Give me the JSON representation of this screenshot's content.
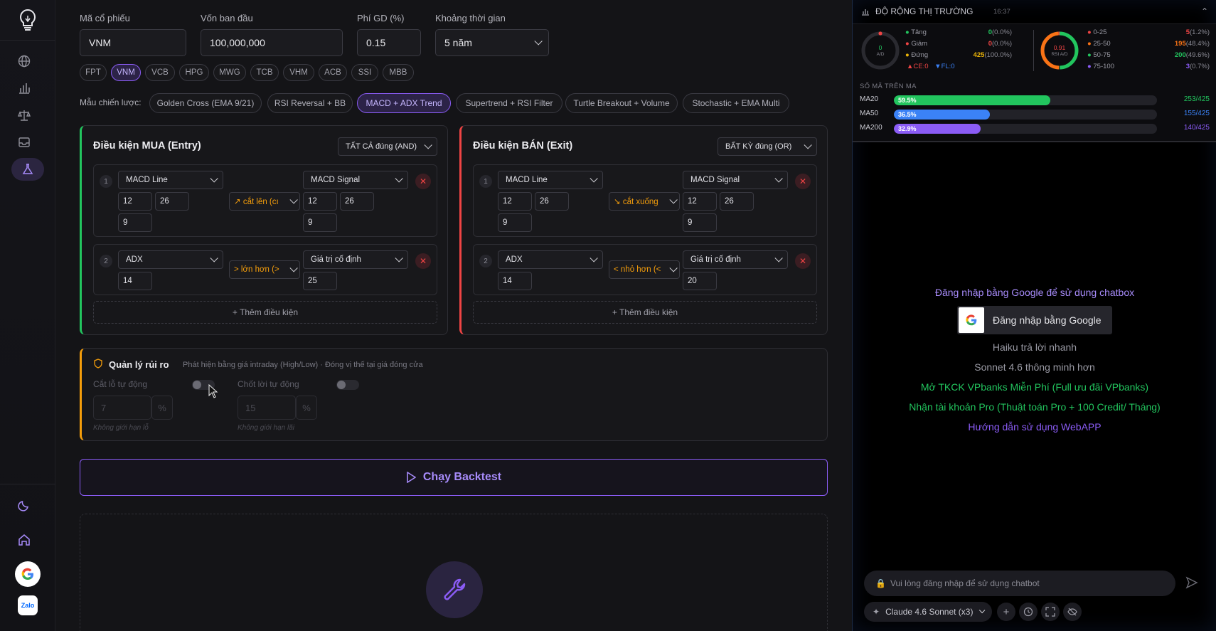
{
  "sidebar": {
    "items": [
      {
        "name": "globe-icon"
      },
      {
        "name": "bar-chart-icon"
      },
      {
        "name": "scale-icon"
      },
      {
        "name": "inbox-icon"
      },
      {
        "name": "flask-icon",
        "active": true
      }
    ],
    "bottom": [
      {
        "name": "moon-icon"
      },
      {
        "name": "home-icon"
      },
      {
        "name": "google-icon"
      },
      {
        "name": "zalo-icon",
        "label": "Zalo"
      }
    ]
  },
  "form": {
    "symbol_label": "Mã cổ phiếu",
    "symbol_value": "VNM",
    "capital_label": "Vốn ban đầu",
    "capital_value": "100,000,000",
    "fee_label": "Phí GD (%)",
    "fee_value": "0.15",
    "period_label": "Khoảng thời gian",
    "period_value": "5 năm"
  },
  "tickers": [
    "FPT",
    "VNM",
    "VCB",
    "HPG",
    "MWG",
    "TCB",
    "VHM",
    "ACB",
    "SSI",
    "MBB"
  ],
  "active_ticker": "VNM",
  "templates": {
    "label": "Mẫu chiến lược:",
    "items": [
      "Golden Cross (EMA 9/21)",
      "RSI Reversal + BB",
      "MACD + ADX Trend",
      "Supertrend + RSI Filter",
      "Turtle Breakout + Volume",
      "Stochastic + EMA Multi"
    ],
    "active": "MACD + ADX Trend"
  },
  "buy": {
    "title": "Điều kiện MUA (Entry)",
    "mode": "TẤT CẢ đúng (AND)",
    "conditions": [
      {
        "num": "1",
        "left": "MACD Line",
        "left_params": [
          "12",
          "26",
          "9"
        ],
        "op": "↗ cắt lên (cı",
        "right": "MACD Signal",
        "right_params": [
          "12",
          "26",
          "9"
        ]
      },
      {
        "num": "2",
        "left": "ADX",
        "left_params": [
          "14"
        ],
        "op": "> lớn hơn (>",
        "right": "Giá trị cố định",
        "right_params": [
          "25"
        ]
      }
    ],
    "add_label": "+ Thêm điều kiện"
  },
  "sell": {
    "title": "Điều kiện BÁN (Exit)",
    "mode": "BẤT KỲ đúng (OR)",
    "conditions": [
      {
        "num": "1",
        "left": "MACD Line",
        "left_params": [
          "12",
          "26",
          "9"
        ],
        "op": "↘ cắt xuống",
        "right": "MACD Signal",
        "right_params": [
          "12",
          "26",
          "9"
        ]
      },
      {
        "num": "2",
        "left": "ADX",
        "left_params": [
          "14"
        ],
        "op": "< nhỏ hơn (<",
        "right": "Giá trị cố định",
        "right_params": [
          "20"
        ]
      }
    ],
    "add_label": "+ Thêm điều kiện"
  },
  "risk": {
    "title": "Quản lý rủi ro",
    "subtitle": "Phát hiện bằng giá intraday (High/Low) · Đóng vị thế tại giá đóng cửa",
    "stop_loss_label": "Cắt lỗ tự động",
    "stop_loss_value": "7",
    "stop_loss_unit": "%",
    "stop_loss_hint": "Không giới hạn lỗ",
    "take_profit_label": "Chốt lời tự động",
    "take_profit_value": "15",
    "take_profit_unit": "%",
    "take_profit_hint": "Không giới hạn lãi"
  },
  "run_label": "Chạy Backtest",
  "market": {
    "title": "ĐỘ RỘNG THỊ TRƯỜNG",
    "time": "16:37",
    "ad_center": "0",
    "ad_sub": "A/D",
    "breadth": [
      {
        "label": "Tăng",
        "color": "#22c55e",
        "value": "0",
        "pct": "(0.0%)"
      },
      {
        "label": "Giảm",
        "color": "#ef4444",
        "value": "0",
        "pct": "(0.0%)"
      },
      {
        "label": "Đứng",
        "color": "#eab308",
        "value": "425",
        "pct": "(100.0%)"
      }
    ],
    "ce": "▲CE:0",
    "fl": "▼FL:0",
    "rsi_center": "0.91",
    "rsi_sub": "RSI A/D",
    "rsi": [
      {
        "label": "0-25",
        "color": "#ef4444",
        "value": "5",
        "pct": "(1.2%)"
      },
      {
        "label": "25-50",
        "color": "#f97316",
        "value": "195",
        "pct": "(48.4%)"
      },
      {
        "label": "50-75",
        "color": "#22c55e",
        "value": "200",
        "pct": "(49.6%)"
      },
      {
        "label": "75-100",
        "color": "#8b5cf6",
        "value": "3",
        "pct": "(0.7%)"
      }
    ],
    "ma_title": "SỐ MÃ TRÊN MA",
    "ma": [
      {
        "label": "MA20",
        "pct_label": "59.5%",
        "fraction": 0.595,
        "count": "253/425",
        "color": "#22c55e"
      },
      {
        "label": "MA50",
        "pct_label": "36.5%",
        "fraction": 0.365,
        "count": "155/425",
        "color": "#3b82f6"
      },
      {
        "label": "MA200",
        "pct_label": "32.9%",
        "fraction": 0.329,
        "count": "140/425",
        "color": "#8b5cf6"
      }
    ]
  },
  "chat": {
    "login_prompt": "Đăng nhập bằng Google để sử dụng chatbox",
    "login_button": "Đăng nhập bằng Google",
    "line1": "Haiku trả lời nhanh",
    "line2": "Sonnet 4.6 thông minh hơn",
    "link1": "Mở TKCK VPbanks Miễn Phí (Full ưu đãi VPbanks)",
    "link2": "Nhận tài khoản Pro (Thuật toán Pro + 100 Credit/ Tháng)",
    "link3": "Hướng dẫn sử dụng WebAPP",
    "input_placeholder": "Vui lòng đăng nhập để sử dụng chatbot",
    "model": "Claude 4.6 Sonnet (x3)"
  }
}
